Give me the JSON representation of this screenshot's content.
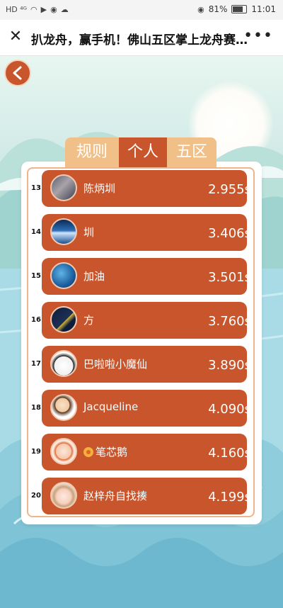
{
  "status_bar": {
    "left_text": "HD ⁴ᴳ",
    "battery": "81%",
    "time": "11:01"
  },
  "titlebar": {
    "title": "扒龙舟，赢手机！佛山五区掌上龙舟赛开...",
    "close_icon": "close-icon",
    "more_icon": "more-icon"
  },
  "tabs": [
    {
      "label": "规则",
      "active": false
    },
    {
      "label": "个人",
      "active": true
    },
    {
      "label": "五区",
      "active": false
    }
  ],
  "colors": {
    "accent": "#c8552b",
    "tab_inactive": "#f1c089",
    "panel_border": "#efb48a"
  },
  "leaderboard": [
    {
      "rank": "13",
      "name": "陈炳圳",
      "time": "2.955s",
      "avatar": "avatar-photo"
    },
    {
      "rank": "14",
      "name": "圳",
      "time": "3.406s",
      "avatar": "avatar-sea"
    },
    {
      "rank": "15",
      "name": "加油",
      "time": "3.501s",
      "avatar": "avatar-earth"
    },
    {
      "rank": "16",
      "name": "方",
      "time": "3.760s",
      "avatar": "avatar-jersey"
    },
    {
      "rank": "17",
      "name": "巴啦啦小魔仙",
      "time": "3.890s",
      "avatar": "avatar-meme"
    },
    {
      "rank": "18",
      "name": "Jacqueline",
      "time": "4.090s",
      "avatar": "avatar-cartoon"
    },
    {
      "rank": "19",
      "name": "笔芯鹅",
      "time": "4.160s",
      "avatar": "avatar-goose"
    },
    {
      "rank": "20",
      "name": "赵梓舟自找揍",
      "time": "4.199s",
      "avatar": "avatar-anime"
    }
  ]
}
